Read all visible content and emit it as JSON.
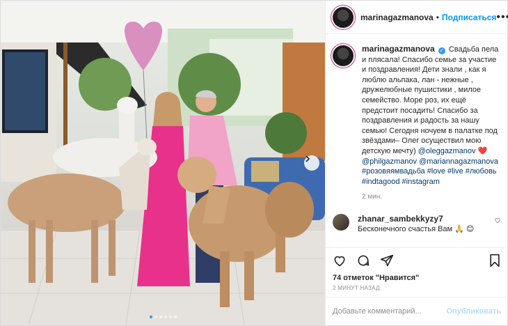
{
  "post": {
    "username": "marinagazmanova",
    "separator": "•",
    "follow_label": "Подписаться",
    "more_label": "•••",
    "caption_pre": "Свадьба пела и плясала! Спасибо семье за участие и поздравления! Дети знали , как я люблю альпака, лан - нежные , дружелюбные пушистики , милое семейство. Море роз, их ещё предстоит посадить! Спасибо за поздравления и радость за нашу семью! Сегодня ночуем в палатке под звёздами– Олег осуществил мою детскую мечту)",
    "mentions": [
      "@oleggazmanov",
      "❤️",
      "@philgazmanov",
      "@mariannagazmanova"
    ],
    "hashtags": [
      "#розовяямвадьба",
      "#love",
      "#live",
      "#любовь",
      "#indtagood",
      "#instagram"
    ],
    "caption_time": "2 мин.",
    "comment": {
      "username": "zhanar_sambekkyzy7",
      "text": "Бесконечного счастья Вам 🙏 😊"
    },
    "likes": "74 отметок \"Нравится\"",
    "posted": "2 МИНУТ НАЗАД",
    "add_comment_placeholder": "Добавьте комментарий...",
    "publish_label": "Опубликовать",
    "carousel": {
      "count": 6,
      "active": 0
    }
  },
  "icons": [
    "heart-icon",
    "comment-icon",
    "share-icon",
    "save-icon",
    "chevron-right-icon",
    "verified-icon"
  ],
  "colors": {
    "accent": "#0095f6",
    "dress": "#e8318a",
    "shirt": "#f2a3c8",
    "balloon": "#d98fbf"
  }
}
